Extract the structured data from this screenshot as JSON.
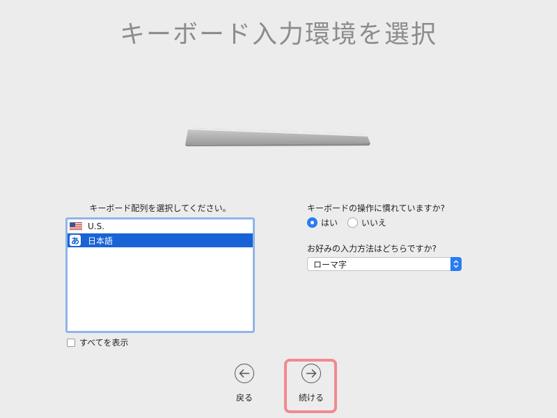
{
  "header": {
    "title": "キーボード入力環境を選択"
  },
  "layout_section": {
    "label": "キーボード配列を選択してください。",
    "items": [
      {
        "label": "U.S.",
        "icon": "us-flag-icon",
        "selected": false
      },
      {
        "label": "日本語",
        "icon": "hiragana-a-icon",
        "badge": "あ",
        "selected": true
      }
    ],
    "show_all_label": "すべてを表示",
    "show_all_checked": false
  },
  "familiarity": {
    "question": "キーボードの操作に慣れていますか?",
    "options": [
      {
        "label": "はい",
        "selected": true
      },
      {
        "label": "いいえ",
        "selected": false
      }
    ]
  },
  "input_method": {
    "question": "お好みの入力方法はどちらですか?",
    "selected": "ローマ字"
  },
  "nav": {
    "back_label": "戻る",
    "continue_label": "続ける"
  },
  "colors": {
    "selection": "#1863d6",
    "accent": "#2a7cf0",
    "list_focus_ring": "#8eb5ea",
    "highlight": "#f08a8f"
  }
}
